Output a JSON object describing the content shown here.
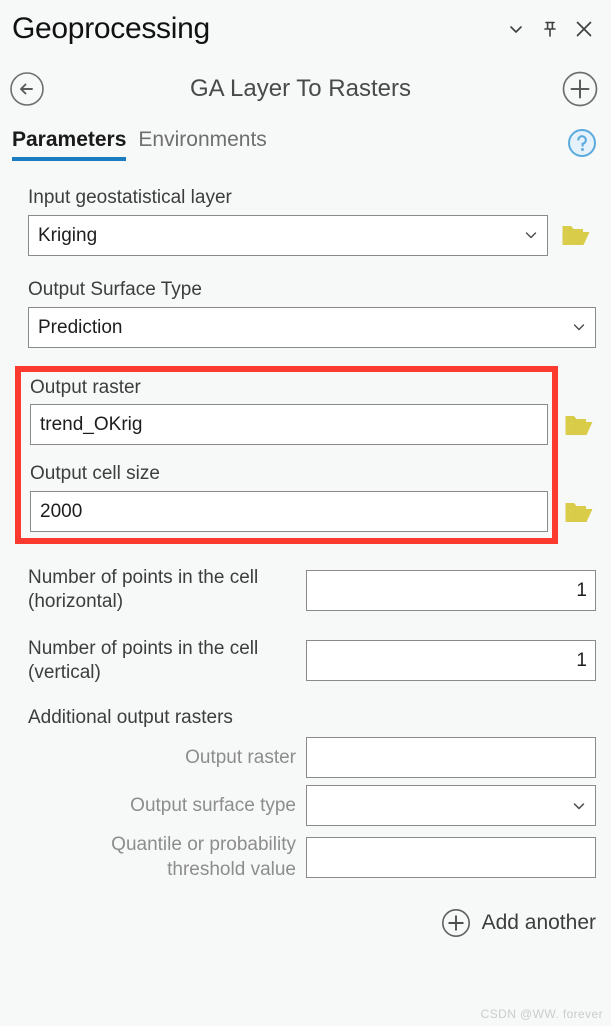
{
  "panel": {
    "title": "Geoprocessing",
    "window_controls": [
      {
        "name": "chevron-down-icon",
        "label": "Collapse"
      },
      {
        "name": "pin-icon",
        "label": "Auto Hide"
      },
      {
        "name": "close-icon",
        "label": "Close"
      }
    ]
  },
  "tool_header": {
    "back_label": "Back",
    "title": "GA Layer To Rasters",
    "add_label": "Add"
  },
  "tabs": {
    "items": [
      {
        "label": "Parameters",
        "active": true
      },
      {
        "label": "Environments",
        "active": false
      }
    ],
    "help_label": "?",
    "accent_color": "#1b7cc2"
  },
  "parameters": {
    "input_layer": {
      "label": "Input geostatistical layer",
      "value": "Kriging",
      "has_browse": true
    },
    "output_surface_type": {
      "label": "Output Surface Type",
      "value": "Prediction",
      "has_browse": false
    },
    "output_raster": {
      "label": "Output raster",
      "value": "trend_OKrig",
      "has_browse": true
    },
    "output_cell_size": {
      "label": "Output cell size",
      "value": "2000",
      "has_browse": true
    },
    "points_horizontal": {
      "label": "Number of points in the cell (horizontal)",
      "value": "1"
    },
    "points_vertical": {
      "label": "Number of points in the cell (vertical)",
      "value": "1"
    }
  },
  "additional_output_rasters": {
    "section_label": "Additional output rasters",
    "rows": [
      {
        "label": "Output raster",
        "value": "",
        "type": "text"
      },
      {
        "label": "Output surface type",
        "value": "",
        "type": "dropdown"
      },
      {
        "label": "Quantile or probability threshold value",
        "value": "",
        "type": "text"
      }
    ],
    "add_another_label": "Add another"
  },
  "highlight": {
    "color": "#fc3b30"
  },
  "watermark": {
    "text": "CSDN @WW. forever"
  }
}
